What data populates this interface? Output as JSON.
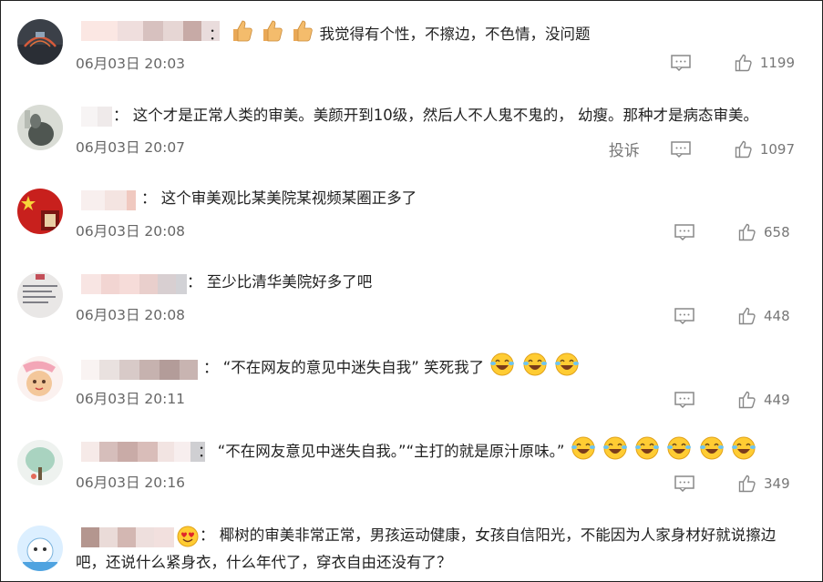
{
  "comments": [
    {
      "separator": "：",
      "text": "我觉得有个性，不擦边，不色情，没问题",
      "time": "06月03日 20:03",
      "likes": "1199",
      "has_report": false,
      "prefix_emoji": "thumbs-up x3"
    },
    {
      "separator": "：",
      "text": "这个才是正常人类的审美。美颜开到10级，然后人不人鬼不鬼的， 幼瘦。那种才是病态审美。",
      "time": "06月03日 20:07",
      "likes": "1097",
      "has_report": true,
      "report_label": "投诉"
    },
    {
      "separator": "：",
      "text": "这个审美观比某美院某视频某圈正多了",
      "time": "06月03日 20:08",
      "likes": "658",
      "has_report": false
    },
    {
      "separator": "：",
      "text": "至少比清华美院好多了吧",
      "time": "06月03日 20:08",
      "likes": "448",
      "has_report": false
    },
    {
      "separator": "：",
      "text": "“不在网友的意见中迷失自我” 笑死我了",
      "time": "06月03日 20:11",
      "likes": "449",
      "has_report": false,
      "suffix_emoji": "laughing-tears x3"
    },
    {
      "separator": "：",
      "text": "“不在网友意见中迷失自我。”“主打的就是原汁原味。”",
      "time": "06月03日 20:16",
      "likes": "349",
      "has_report": false,
      "suffix_emoji": "laughing-tears x6"
    },
    {
      "separator": "：",
      "text": "椰树的审美非常正常，男孩运动健康，女孩自信阳光，不能因为人家身材好就说擦边吧，还说什么紧身衣，什么年代了，穿衣自由还没有了？",
      "has_report": false
    }
  ],
  "colors": {
    "text": "#222222",
    "meta": "#666666",
    "icon": "#888888"
  }
}
